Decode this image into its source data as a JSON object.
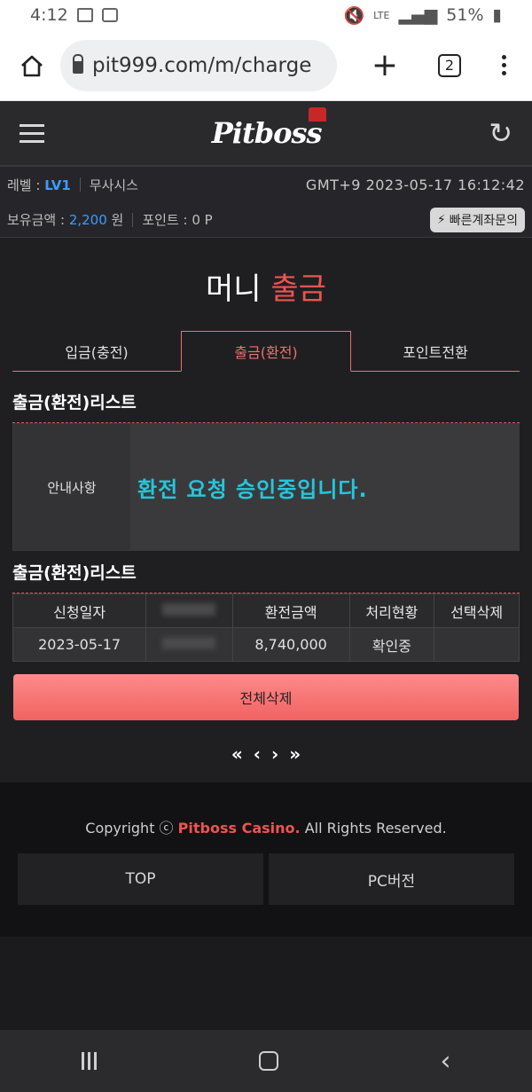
{
  "status_bar": {
    "time": "4:12",
    "network": "LTE",
    "battery": "51%"
  },
  "browser": {
    "url": "pit999.com/m/charge",
    "tab_count": "2",
    "plus": "+"
  },
  "header": {
    "logo": "Pitboss"
  },
  "user_info": {
    "level_label": "레벨 :",
    "level_value": "LV1",
    "username": "무사시스",
    "datetime": "GMT+9 2023-05-17 16:12:42",
    "balance_label": "보유금액 :",
    "balance_value": "2,200",
    "balance_unit": "원",
    "points_label": "포인트 :",
    "points_value": "0 P",
    "quick_button": "빠른계좌문의"
  },
  "page": {
    "title_plain": "머니",
    "title_highlight": "출금",
    "tabs": [
      {
        "label": "입금(충전)"
      },
      {
        "label": "출금(환전)"
      },
      {
        "label": "포인트전환"
      }
    ],
    "section1_title": "출금(환전)리스트",
    "notice_label": "안내사항",
    "notice_text": "환전 요청 승인중입니다.",
    "section2_title": "출금(환전)리스트",
    "table": {
      "headers": [
        "신청일자",
        "",
        "환전금액",
        "처리현황",
        "선택삭제"
      ],
      "rows": [
        [
          "2023-05-17",
          "",
          "8,740,000",
          "확인중",
          ""
        ]
      ]
    },
    "delete_all": "전체삭제",
    "pager": {
      "first": "«",
      "prev": "‹",
      "next": "›",
      "last": "»"
    }
  },
  "footer": {
    "copyright_prefix": "Copyright ⓒ",
    "brand": "Pitboss Casino.",
    "copyright_suffix": "All Rights Reserved.",
    "top_button": "TOP",
    "pc_button": "PC버전"
  },
  "colors": {
    "accent_red": "#ef5350",
    "accent_blue": "#3b9cff",
    "notice_cyan": "#26c6da",
    "button_pink": "#f06262"
  }
}
